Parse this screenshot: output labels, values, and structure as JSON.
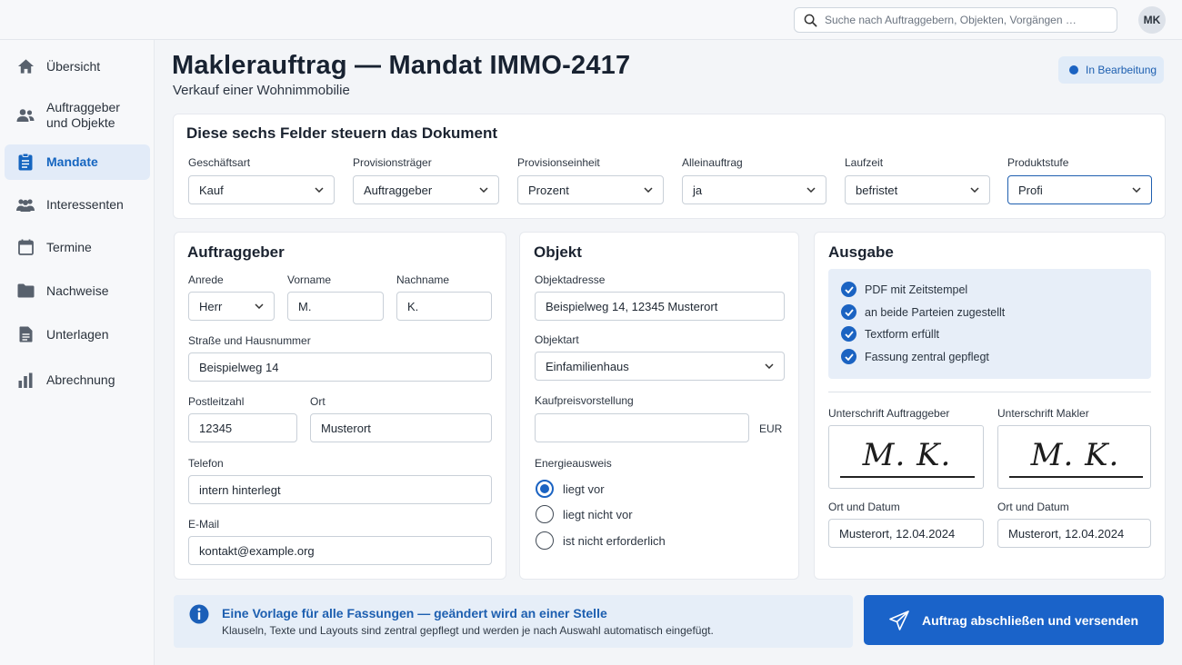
{
  "topbar": {
    "search_placeholder": "Suche nach Auftraggebern, Objekten, Vorgängen …",
    "avatar_initials": "MK"
  },
  "sidebar": {
    "items": [
      {
        "label": "Übersicht",
        "icon": "home-icon"
      },
      {
        "label": "Auftraggeber und Objekte",
        "icon": "people-icon"
      },
      {
        "label": "Mandate",
        "icon": "document-icon",
        "active": true
      },
      {
        "label": "Interessenten",
        "icon": "group-icon"
      },
      {
        "label": "Termine",
        "icon": "calendar-icon"
      },
      {
        "label": "Nachweise",
        "icon": "folder-icon"
      },
      {
        "label": "Unterlagen",
        "icon": "file-icon"
      },
      {
        "label": "Abrechnung",
        "icon": "bar-chart-icon"
      }
    ]
  },
  "header": {
    "title": "Maklerauftrag — Mandat IMMO-2417",
    "subtitle": "Verkauf einer Wohnimmobilie",
    "status": "In Bearbeitung"
  },
  "controls": {
    "title": "Diese sechs Felder steuern das Dokument",
    "fields": [
      {
        "label": "Geschäftsart",
        "value": "Kauf"
      },
      {
        "label": "Provisionsträger",
        "value": "Auftraggeber"
      },
      {
        "label": "Provisionseinheit",
        "value": "Prozent"
      },
      {
        "label": "Alleinauftrag",
        "value": "ja"
      },
      {
        "label": "Laufzeit",
        "value": "befristet"
      },
      {
        "label": "Produktstufe",
        "value": "Profi"
      }
    ]
  },
  "client": {
    "title": "Auftraggeber",
    "salutation_label": "Anrede",
    "salutation": "Herr",
    "firstname_label": "Vorname",
    "firstname": "M.",
    "lastname_label": "Nachname",
    "lastname": "K.",
    "street_label": "Straße und Hausnummer",
    "street": "Beispielweg 14",
    "zip_label": "Postleitzahl",
    "zip": "12345",
    "city_label": "Ort",
    "city": "Musterort",
    "phone_label": "Telefon",
    "phone": "intern hinterlegt",
    "email_label": "E-Mail",
    "email": "kontakt@example.org"
  },
  "object": {
    "title": "Objekt",
    "address_label": "Objektadresse",
    "address": "Beispielweg 14, 12345 Musterort",
    "type_label": "Objektart",
    "type": "Einfamilienhaus",
    "price_label": "Kaufpreisvorstellung",
    "price": "",
    "currency": "EUR",
    "energy_label": "Energieausweis",
    "energy_options": [
      {
        "label": "liegt vor",
        "selected": true
      },
      {
        "label": "liegt nicht vor",
        "selected": false
      },
      {
        "label": "ist nicht erforderlich",
        "selected": false
      }
    ]
  },
  "output": {
    "title": "Ausgabe",
    "checks": [
      "PDF mit Zeitstempel",
      "an beide Parteien zugestellt",
      "Textform erfüllt",
      "Fassung zentral gepflegt"
    ],
    "sig_client_label": "Unterschrift Auftraggeber",
    "sig_broker_label": "Unterschrift Makler",
    "signature_text": "M. K.",
    "date_label": "Ort und Datum",
    "date_client": "Musterort, 12.04.2024",
    "date_broker": "Musterort, 12.04.2024"
  },
  "footer": {
    "info_title": "Eine Vorlage für alle Fassungen — geändert wird an einer Stelle",
    "info_text": "Klauseln, Texte und Layouts sind zentral gepflegt und werden je nach Auswahl automatisch eingefügt.",
    "send_label": "Auftrag abschließen und versenden"
  },
  "colors": {
    "accent": "#1a63c9",
    "active_nav_bg": "#e2ebf8",
    "info_bg": "#e6eef8"
  }
}
